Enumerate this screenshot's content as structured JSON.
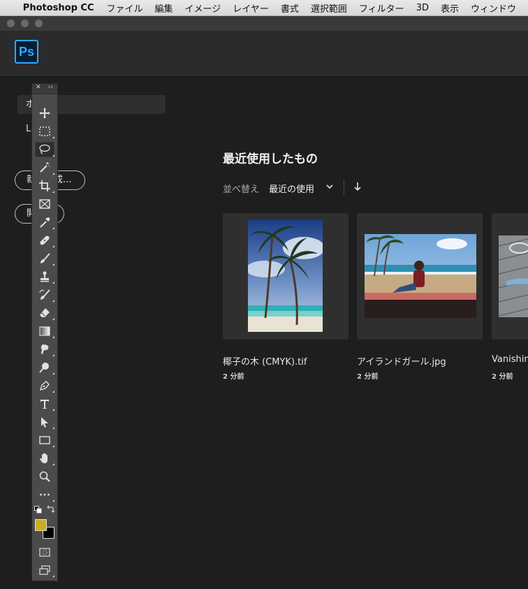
{
  "menubar": {
    "app_name": "Photoshop CC",
    "items": [
      "ファイル",
      "編集",
      "イメージ",
      "レイヤー",
      "書式",
      "選択範囲",
      "フィルター",
      "3D",
      "表示",
      "ウィンドウ"
    ]
  },
  "header": {
    "logo_text": "Ps"
  },
  "sidebar": {
    "home_label": "ホーム",
    "lr_label": "LR写真",
    "new_button": "新規作成...",
    "open_button": "開く"
  },
  "tools": {
    "items": [
      "move",
      "marquee",
      "lasso",
      "magic-wand",
      "crop",
      "frame",
      "eyedropper",
      "healing-brush",
      "brush",
      "clone-stamp",
      "history-brush",
      "eraser",
      "gradient",
      "blur",
      "dodge",
      "pen",
      "type",
      "path-selection",
      "rectangle",
      "hand",
      "zoom",
      "edit-toolbar"
    ],
    "foreground_color": "#c9ae1f",
    "background_color": "#000000"
  },
  "main": {
    "section_title": "最近使用したもの",
    "sort_label": "並べ替え",
    "sort_value": "最近の使用",
    "recent_files": [
      {
        "name": "椰子の木 (CMYK).tif",
        "time": "2 分前"
      },
      {
        "name": "アイランドガール.jpg",
        "time": "2 分前"
      },
      {
        "name": "Vanishing",
        "time": "2 分前"
      }
    ]
  },
  "colors": {
    "accent": "#31a8ff",
    "panel": "#4b4b4b",
    "background": "#1e1e1e"
  }
}
